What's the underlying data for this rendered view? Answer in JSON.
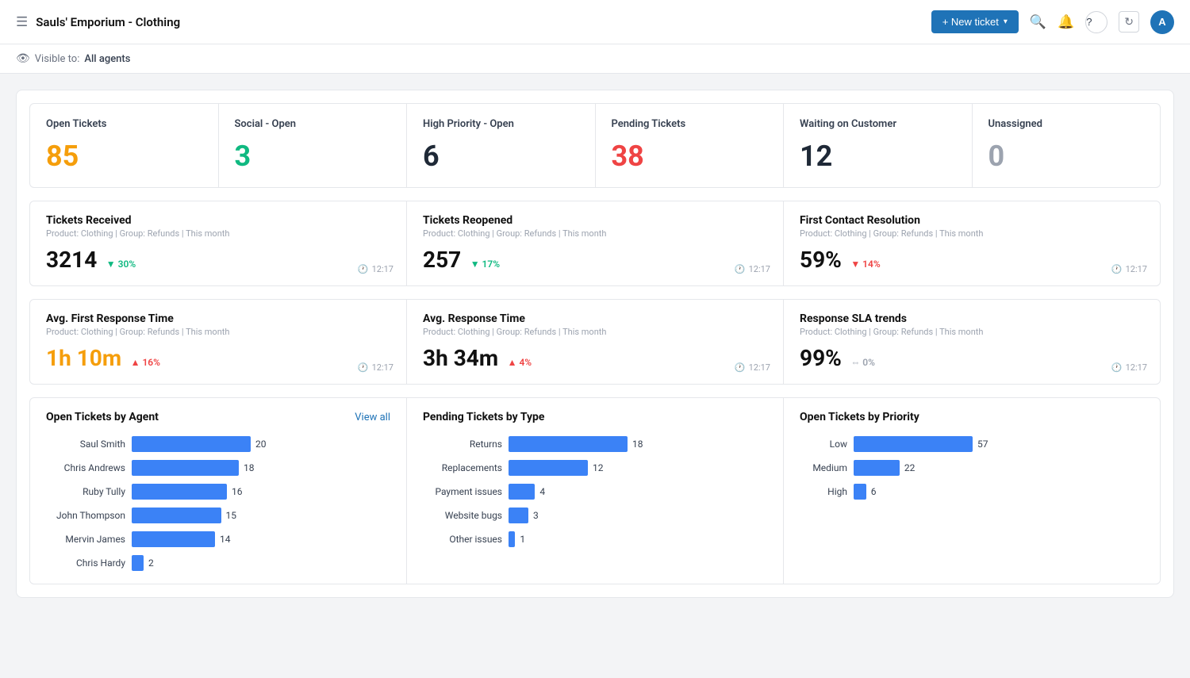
{
  "header": {
    "menu_icon": "☰",
    "title": "Sauls' Emporium - Clothing",
    "new_ticket_label": "+ New ticket",
    "search_icon": "🔍",
    "bell_icon": "🔔",
    "help_icon": "?",
    "refresh_icon": "↻",
    "avatar_label": "A"
  },
  "sub_header": {
    "eye_icon": "👁",
    "prefix": "Visible to:",
    "label": "All agents"
  },
  "stat_cards": [
    {
      "label": "Open Tickets",
      "value": "85",
      "color": "val-orange"
    },
    {
      "label": "Social - Open",
      "value": "3",
      "color": "val-green"
    },
    {
      "label": "High Priority - Open",
      "value": "6",
      "color": "val-dark"
    },
    {
      "label": "Pending Tickets",
      "value": "38",
      "color": "val-red"
    },
    {
      "label": "Waiting on Customer",
      "value": "12",
      "color": "val-dark"
    },
    {
      "label": "Unassigned",
      "value": "0",
      "color": "val-gray"
    }
  ],
  "metrics_row1": [
    {
      "title": "Tickets Received",
      "subtitle": "Product: Clothing | Group: Refunds | This month",
      "value": "3214",
      "badge": "▼ 30%",
      "badge_color": "badge-green",
      "time": "12:17"
    },
    {
      "title": "Tickets Reopened",
      "subtitle": "Product: Clothing | Group: Refunds | This month",
      "value": "257",
      "badge": "▼ 17%",
      "badge_color": "badge-green",
      "time": "12:17"
    },
    {
      "title": "First Contact Resolution",
      "subtitle": "Product: Clothing | Group: Refunds | This month",
      "value": "59%",
      "badge": "▼ 14%",
      "badge_color": "badge-red",
      "time": "12:17"
    }
  ],
  "metrics_row2": [
    {
      "title": "Avg. First Response Time",
      "subtitle": "Product: Clothing | Group: Refunds | This month",
      "value": "1h 10m",
      "value_color": "metric-value-orange",
      "badge": "▲ 16%",
      "badge_color": "badge-red",
      "time": "12:17"
    },
    {
      "title": "Avg. Response Time",
      "subtitle": "Product: Clothing | Group: Refunds | This month",
      "value": "3h 34m",
      "value_color": "",
      "badge": "▲ 4%",
      "badge_color": "badge-red",
      "time": "12:17"
    },
    {
      "title": "Response SLA trends",
      "subtitle": "Product: Clothing | Group: Refunds | This month",
      "value": "99%",
      "value_color": "",
      "badge": "⇔ 0%",
      "badge_color": "badge-gray",
      "time": "12:17"
    }
  ],
  "charts": {
    "agents": {
      "title": "Open Tickets by Agent",
      "view_all": "View all",
      "max_val": 20,
      "items": [
        {
          "label": "Saul Smith",
          "value": 20
        },
        {
          "label": "Chris Andrews",
          "value": 18
        },
        {
          "label": "Ruby Tully",
          "value": 16
        },
        {
          "label": "John Thompson",
          "value": 15
        },
        {
          "label": "Mervin James",
          "value": 14
        },
        {
          "label": "Chris Hardy",
          "value": 2
        }
      ]
    },
    "pending": {
      "title": "Pending Tickets by Type",
      "max_val": 18,
      "items": [
        {
          "label": "Returns",
          "value": 18
        },
        {
          "label": "Replacements",
          "value": 12
        },
        {
          "label": "Payment issues",
          "value": 4
        },
        {
          "label": "Website bugs",
          "value": 3
        },
        {
          "label": "Other issues",
          "value": 1
        }
      ]
    },
    "priority": {
      "title": "Open Tickets by Priority",
      "max_val": 57,
      "items": [
        {
          "label": "Low",
          "value": 57
        },
        {
          "label": "Medium",
          "value": 22
        },
        {
          "label": "High",
          "value": 6
        }
      ]
    }
  }
}
